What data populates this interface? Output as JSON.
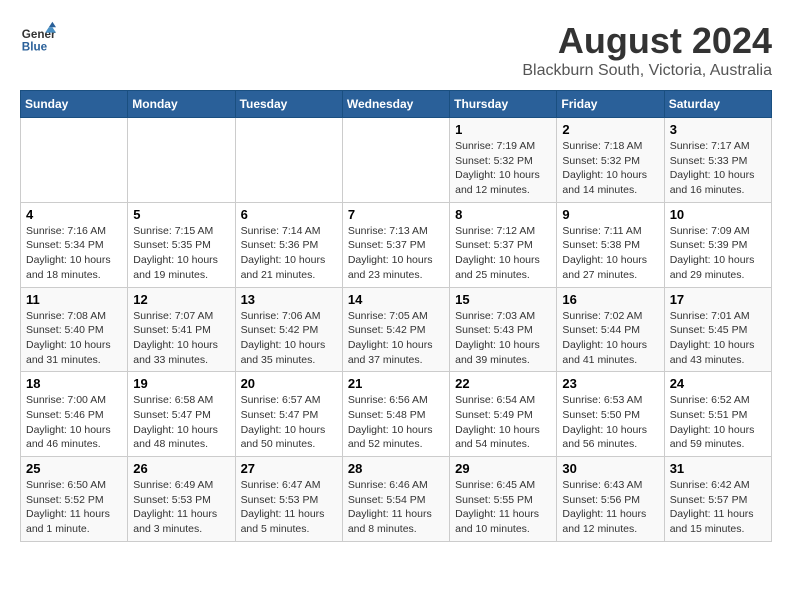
{
  "logo": {
    "line1": "General",
    "line2": "Blue"
  },
  "title": "August 2024",
  "subtitle": "Blackburn South, Victoria, Australia",
  "headers": [
    "Sunday",
    "Monday",
    "Tuesday",
    "Wednesday",
    "Thursday",
    "Friday",
    "Saturday"
  ],
  "weeks": [
    [
      {
        "day": "",
        "info": ""
      },
      {
        "day": "",
        "info": ""
      },
      {
        "day": "",
        "info": ""
      },
      {
        "day": "",
        "info": ""
      },
      {
        "day": "1",
        "info": "Sunrise: 7:19 AM\nSunset: 5:32 PM\nDaylight: 10 hours\nand 12 minutes."
      },
      {
        "day": "2",
        "info": "Sunrise: 7:18 AM\nSunset: 5:32 PM\nDaylight: 10 hours\nand 14 minutes."
      },
      {
        "day": "3",
        "info": "Sunrise: 7:17 AM\nSunset: 5:33 PM\nDaylight: 10 hours\nand 16 minutes."
      }
    ],
    [
      {
        "day": "4",
        "info": "Sunrise: 7:16 AM\nSunset: 5:34 PM\nDaylight: 10 hours\nand 18 minutes."
      },
      {
        "day": "5",
        "info": "Sunrise: 7:15 AM\nSunset: 5:35 PM\nDaylight: 10 hours\nand 19 minutes."
      },
      {
        "day": "6",
        "info": "Sunrise: 7:14 AM\nSunset: 5:36 PM\nDaylight: 10 hours\nand 21 minutes."
      },
      {
        "day": "7",
        "info": "Sunrise: 7:13 AM\nSunset: 5:37 PM\nDaylight: 10 hours\nand 23 minutes."
      },
      {
        "day": "8",
        "info": "Sunrise: 7:12 AM\nSunset: 5:37 PM\nDaylight: 10 hours\nand 25 minutes."
      },
      {
        "day": "9",
        "info": "Sunrise: 7:11 AM\nSunset: 5:38 PM\nDaylight: 10 hours\nand 27 minutes."
      },
      {
        "day": "10",
        "info": "Sunrise: 7:09 AM\nSunset: 5:39 PM\nDaylight: 10 hours\nand 29 minutes."
      }
    ],
    [
      {
        "day": "11",
        "info": "Sunrise: 7:08 AM\nSunset: 5:40 PM\nDaylight: 10 hours\nand 31 minutes."
      },
      {
        "day": "12",
        "info": "Sunrise: 7:07 AM\nSunset: 5:41 PM\nDaylight: 10 hours\nand 33 minutes."
      },
      {
        "day": "13",
        "info": "Sunrise: 7:06 AM\nSunset: 5:42 PM\nDaylight: 10 hours\nand 35 minutes."
      },
      {
        "day": "14",
        "info": "Sunrise: 7:05 AM\nSunset: 5:42 PM\nDaylight: 10 hours\nand 37 minutes."
      },
      {
        "day": "15",
        "info": "Sunrise: 7:03 AM\nSunset: 5:43 PM\nDaylight: 10 hours\nand 39 minutes."
      },
      {
        "day": "16",
        "info": "Sunrise: 7:02 AM\nSunset: 5:44 PM\nDaylight: 10 hours\nand 41 minutes."
      },
      {
        "day": "17",
        "info": "Sunrise: 7:01 AM\nSunset: 5:45 PM\nDaylight: 10 hours\nand 43 minutes."
      }
    ],
    [
      {
        "day": "18",
        "info": "Sunrise: 7:00 AM\nSunset: 5:46 PM\nDaylight: 10 hours\nand 46 minutes."
      },
      {
        "day": "19",
        "info": "Sunrise: 6:58 AM\nSunset: 5:47 PM\nDaylight: 10 hours\nand 48 minutes."
      },
      {
        "day": "20",
        "info": "Sunrise: 6:57 AM\nSunset: 5:47 PM\nDaylight: 10 hours\nand 50 minutes."
      },
      {
        "day": "21",
        "info": "Sunrise: 6:56 AM\nSunset: 5:48 PM\nDaylight: 10 hours\nand 52 minutes."
      },
      {
        "day": "22",
        "info": "Sunrise: 6:54 AM\nSunset: 5:49 PM\nDaylight: 10 hours\nand 54 minutes."
      },
      {
        "day": "23",
        "info": "Sunrise: 6:53 AM\nSunset: 5:50 PM\nDaylight: 10 hours\nand 56 minutes."
      },
      {
        "day": "24",
        "info": "Sunrise: 6:52 AM\nSunset: 5:51 PM\nDaylight: 10 hours\nand 59 minutes."
      }
    ],
    [
      {
        "day": "25",
        "info": "Sunrise: 6:50 AM\nSunset: 5:52 PM\nDaylight: 11 hours\nand 1 minute."
      },
      {
        "day": "26",
        "info": "Sunrise: 6:49 AM\nSunset: 5:53 PM\nDaylight: 11 hours\nand 3 minutes."
      },
      {
        "day": "27",
        "info": "Sunrise: 6:47 AM\nSunset: 5:53 PM\nDaylight: 11 hours\nand 5 minutes."
      },
      {
        "day": "28",
        "info": "Sunrise: 6:46 AM\nSunset: 5:54 PM\nDaylight: 11 hours\nand 8 minutes."
      },
      {
        "day": "29",
        "info": "Sunrise: 6:45 AM\nSunset: 5:55 PM\nDaylight: 11 hours\nand 10 minutes."
      },
      {
        "day": "30",
        "info": "Sunrise: 6:43 AM\nSunset: 5:56 PM\nDaylight: 11 hours\nand 12 minutes."
      },
      {
        "day": "31",
        "info": "Sunrise: 6:42 AM\nSunset: 5:57 PM\nDaylight: 11 hours\nand 15 minutes."
      }
    ]
  ]
}
